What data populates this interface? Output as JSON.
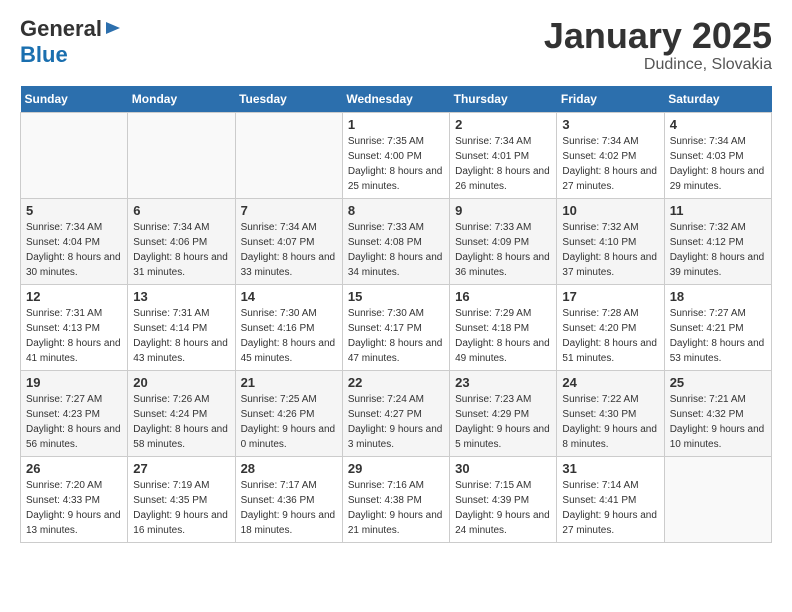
{
  "logo": {
    "general": "General",
    "blue": "Blue"
  },
  "title": "January 2025",
  "location": "Dudince, Slovakia",
  "days_of_week": [
    "Sunday",
    "Monday",
    "Tuesday",
    "Wednesday",
    "Thursday",
    "Friday",
    "Saturday"
  ],
  "weeks": [
    [
      {
        "day": "",
        "sunrise": "",
        "sunset": "",
        "daylight": "",
        "empty": true
      },
      {
        "day": "",
        "sunrise": "",
        "sunset": "",
        "daylight": "",
        "empty": true
      },
      {
        "day": "",
        "sunrise": "",
        "sunset": "",
        "daylight": "",
        "empty": true
      },
      {
        "day": "1",
        "sunrise": "Sunrise: 7:35 AM",
        "sunset": "Sunset: 4:00 PM",
        "daylight": "Daylight: 8 hours and 25 minutes."
      },
      {
        "day": "2",
        "sunrise": "Sunrise: 7:34 AM",
        "sunset": "Sunset: 4:01 PM",
        "daylight": "Daylight: 8 hours and 26 minutes."
      },
      {
        "day": "3",
        "sunrise": "Sunrise: 7:34 AM",
        "sunset": "Sunset: 4:02 PM",
        "daylight": "Daylight: 8 hours and 27 minutes."
      },
      {
        "day": "4",
        "sunrise": "Sunrise: 7:34 AM",
        "sunset": "Sunset: 4:03 PM",
        "daylight": "Daylight: 8 hours and 29 minutes."
      }
    ],
    [
      {
        "day": "5",
        "sunrise": "Sunrise: 7:34 AM",
        "sunset": "Sunset: 4:04 PM",
        "daylight": "Daylight: 8 hours and 30 minutes."
      },
      {
        "day": "6",
        "sunrise": "Sunrise: 7:34 AM",
        "sunset": "Sunset: 4:06 PM",
        "daylight": "Daylight: 8 hours and 31 minutes."
      },
      {
        "day": "7",
        "sunrise": "Sunrise: 7:34 AM",
        "sunset": "Sunset: 4:07 PM",
        "daylight": "Daylight: 8 hours and 33 minutes."
      },
      {
        "day": "8",
        "sunrise": "Sunrise: 7:33 AM",
        "sunset": "Sunset: 4:08 PM",
        "daylight": "Daylight: 8 hours and 34 minutes."
      },
      {
        "day": "9",
        "sunrise": "Sunrise: 7:33 AM",
        "sunset": "Sunset: 4:09 PM",
        "daylight": "Daylight: 8 hours and 36 minutes."
      },
      {
        "day": "10",
        "sunrise": "Sunrise: 7:32 AM",
        "sunset": "Sunset: 4:10 PM",
        "daylight": "Daylight: 8 hours and 37 minutes."
      },
      {
        "day": "11",
        "sunrise": "Sunrise: 7:32 AM",
        "sunset": "Sunset: 4:12 PM",
        "daylight": "Daylight: 8 hours and 39 minutes."
      }
    ],
    [
      {
        "day": "12",
        "sunrise": "Sunrise: 7:31 AM",
        "sunset": "Sunset: 4:13 PM",
        "daylight": "Daylight: 8 hours and 41 minutes."
      },
      {
        "day": "13",
        "sunrise": "Sunrise: 7:31 AM",
        "sunset": "Sunset: 4:14 PM",
        "daylight": "Daylight: 8 hours and 43 minutes."
      },
      {
        "day": "14",
        "sunrise": "Sunrise: 7:30 AM",
        "sunset": "Sunset: 4:16 PM",
        "daylight": "Daylight: 8 hours and 45 minutes."
      },
      {
        "day": "15",
        "sunrise": "Sunrise: 7:30 AM",
        "sunset": "Sunset: 4:17 PM",
        "daylight": "Daylight: 8 hours and 47 minutes."
      },
      {
        "day": "16",
        "sunrise": "Sunrise: 7:29 AM",
        "sunset": "Sunset: 4:18 PM",
        "daylight": "Daylight: 8 hours and 49 minutes."
      },
      {
        "day": "17",
        "sunrise": "Sunrise: 7:28 AM",
        "sunset": "Sunset: 4:20 PM",
        "daylight": "Daylight: 8 hours and 51 minutes."
      },
      {
        "day": "18",
        "sunrise": "Sunrise: 7:27 AM",
        "sunset": "Sunset: 4:21 PM",
        "daylight": "Daylight: 8 hours and 53 minutes."
      }
    ],
    [
      {
        "day": "19",
        "sunrise": "Sunrise: 7:27 AM",
        "sunset": "Sunset: 4:23 PM",
        "daylight": "Daylight: 8 hours and 56 minutes."
      },
      {
        "day": "20",
        "sunrise": "Sunrise: 7:26 AM",
        "sunset": "Sunset: 4:24 PM",
        "daylight": "Daylight: 8 hours and 58 minutes."
      },
      {
        "day": "21",
        "sunrise": "Sunrise: 7:25 AM",
        "sunset": "Sunset: 4:26 PM",
        "daylight": "Daylight: 9 hours and 0 minutes."
      },
      {
        "day": "22",
        "sunrise": "Sunrise: 7:24 AM",
        "sunset": "Sunset: 4:27 PM",
        "daylight": "Daylight: 9 hours and 3 minutes."
      },
      {
        "day": "23",
        "sunrise": "Sunrise: 7:23 AM",
        "sunset": "Sunset: 4:29 PM",
        "daylight": "Daylight: 9 hours and 5 minutes."
      },
      {
        "day": "24",
        "sunrise": "Sunrise: 7:22 AM",
        "sunset": "Sunset: 4:30 PM",
        "daylight": "Daylight: 9 hours and 8 minutes."
      },
      {
        "day": "25",
        "sunrise": "Sunrise: 7:21 AM",
        "sunset": "Sunset: 4:32 PM",
        "daylight": "Daylight: 9 hours and 10 minutes."
      }
    ],
    [
      {
        "day": "26",
        "sunrise": "Sunrise: 7:20 AM",
        "sunset": "Sunset: 4:33 PM",
        "daylight": "Daylight: 9 hours and 13 minutes."
      },
      {
        "day": "27",
        "sunrise": "Sunrise: 7:19 AM",
        "sunset": "Sunset: 4:35 PM",
        "daylight": "Daylight: 9 hours and 16 minutes."
      },
      {
        "day": "28",
        "sunrise": "Sunrise: 7:17 AM",
        "sunset": "Sunset: 4:36 PM",
        "daylight": "Daylight: 9 hours and 18 minutes."
      },
      {
        "day": "29",
        "sunrise": "Sunrise: 7:16 AM",
        "sunset": "Sunset: 4:38 PM",
        "daylight": "Daylight: 9 hours and 21 minutes."
      },
      {
        "day": "30",
        "sunrise": "Sunrise: 7:15 AM",
        "sunset": "Sunset: 4:39 PM",
        "daylight": "Daylight: 9 hours and 24 minutes."
      },
      {
        "day": "31",
        "sunrise": "Sunrise: 7:14 AM",
        "sunset": "Sunset: 4:41 PM",
        "daylight": "Daylight: 9 hours and 27 minutes."
      },
      {
        "day": "",
        "sunrise": "",
        "sunset": "",
        "daylight": "",
        "empty": true
      }
    ]
  ]
}
